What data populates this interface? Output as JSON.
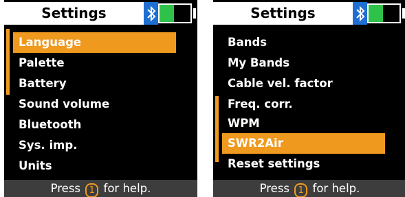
{
  "colors": {
    "accent": "#ef9a1f",
    "bluetooth": "#1e6fd1",
    "battery": "#2fc24a",
    "footer_bg": "#3d3d3d"
  },
  "left_screen": {
    "title": "Settings",
    "battery_level": 0.47,
    "selected_index": 0,
    "items": [
      "Language",
      "Palette",
      "Battery",
      "Sound volume",
      "Bluetooth",
      "Sys. imp.",
      "Units"
    ],
    "footer": {
      "prefix": "Press",
      "key": "1",
      "suffix": "for help."
    }
  },
  "right_screen": {
    "title": "Settings",
    "battery_level": 0.47,
    "selected_index": 5,
    "items": [
      "Bands",
      "My Bands",
      "Cable vel. factor",
      "Freq. corr.",
      "WPM",
      "SWR2Air",
      "Reset settings"
    ],
    "footer": {
      "prefix": "Press",
      "key": "1",
      "suffix": "for help."
    }
  },
  "icons": {
    "bluetooth": "bluetooth-icon",
    "battery": "battery-icon",
    "help_key": "key-1-icon"
  }
}
